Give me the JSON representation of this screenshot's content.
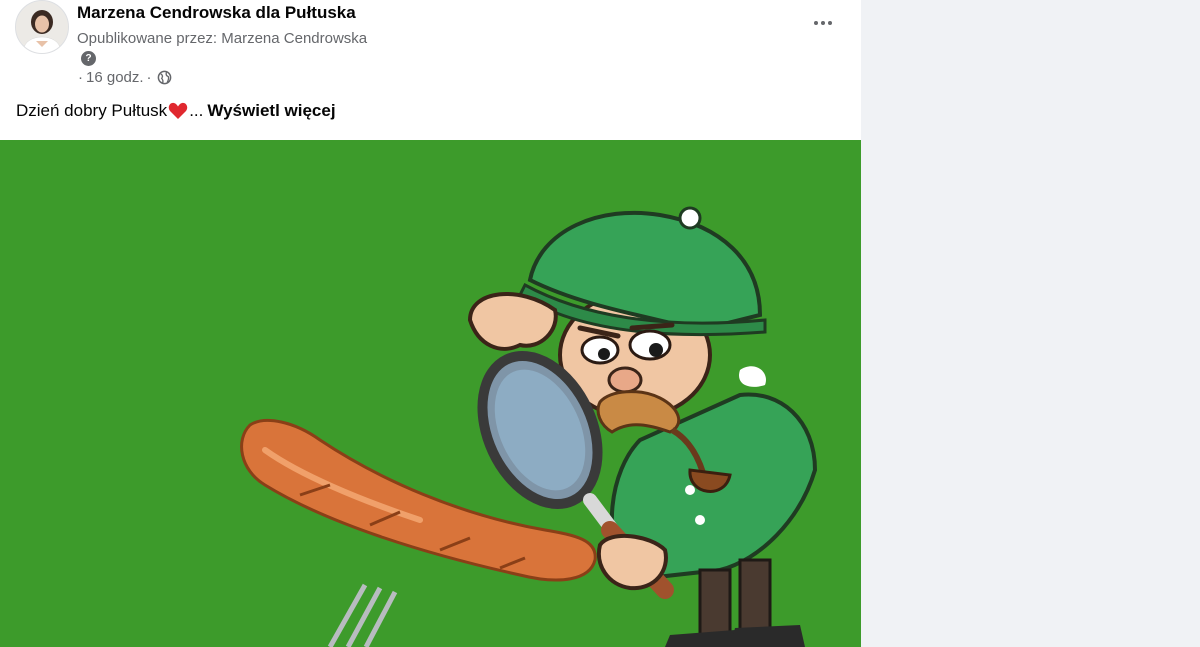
{
  "post": {
    "author": "Marzena Cendrowska dla Pułtuska",
    "published_by_prefix": "Opublikowane przez:",
    "published_by_name": "Marzena Cendrowska",
    "time_prefix": "·",
    "time": "16 godz.",
    "time_suffix": "·",
    "privacy_icon": "globe-icon",
    "menu_icon": "more-options-icon",
    "message_text": "Dzień dobry Pułtusk",
    "message_emoji": "heart-icon",
    "ellipsis": "...",
    "see_more": "Wyświetl więcej",
    "image_alt": "detective-with-magnifying-glass-and-sausage"
  },
  "colors": {
    "image_background": "#3d9b2b",
    "page_background": "#f0f2f5",
    "secondary_text": "#65676b"
  }
}
